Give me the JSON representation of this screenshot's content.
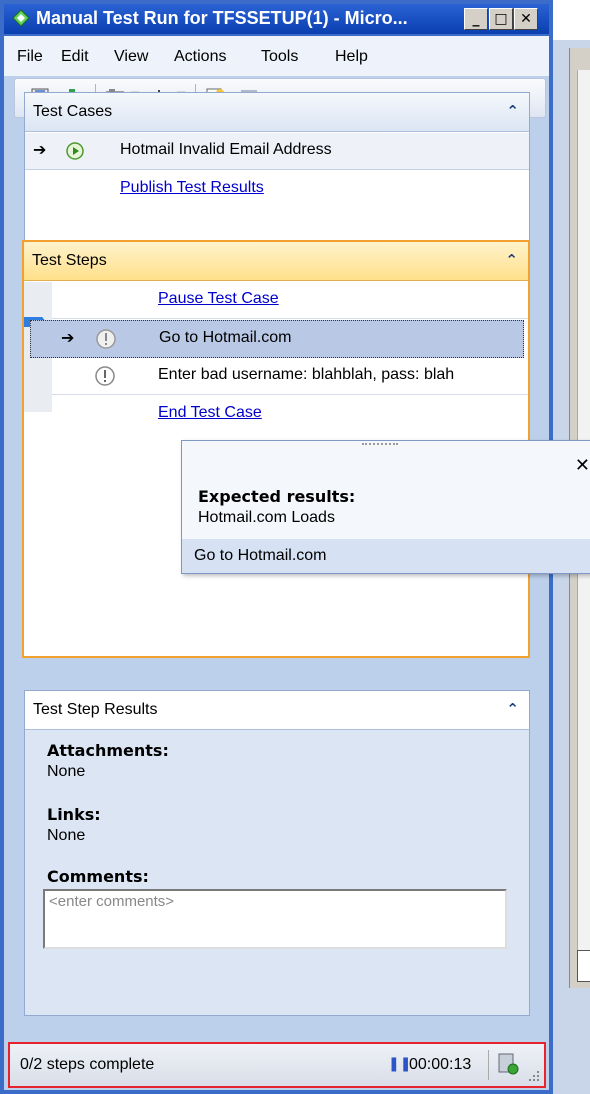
{
  "window": {
    "title": "Manual Test Run for TFSSETUP(1) - Micro..."
  },
  "menu": [
    "File",
    "Edit",
    "View",
    "Actions",
    "Tools",
    "Help"
  ],
  "test_cases": {
    "title": "Test Cases",
    "case": "Hotmail Invalid Email Address",
    "publish_link": "Publish Test Results"
  },
  "test_steps": {
    "title": "Test Steps",
    "pause_link": "Pause Test Case",
    "steps": [
      "Go to Hotmail.com",
      "Enter bad username: blahblah, pass: blah"
    ],
    "end_link": "End Test Case"
  },
  "popup": {
    "expected_label": "Expected results:",
    "expected_value": "Hotmail.com Loads",
    "footer": "Go to Hotmail.com"
  },
  "results": {
    "title": "Test Step Results",
    "attachments_label": "Attachments:",
    "attachments_value": "None",
    "links_label": "Links:",
    "links_value": "None",
    "comments_label": "Comments:",
    "comments_placeholder": "<enter comments>"
  },
  "status": {
    "steps_complete": "0/2 steps complete",
    "timer": "00:00:13"
  }
}
